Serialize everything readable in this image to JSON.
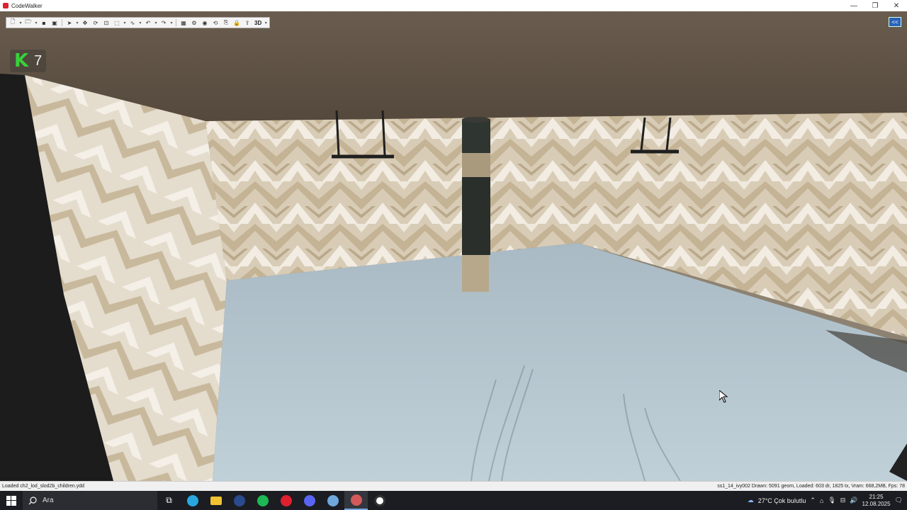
{
  "window": {
    "title": "CodeWalker",
    "controls": [
      "—",
      "❐",
      "✕"
    ]
  },
  "toolbar": {
    "view_mode": "3D",
    "collapse_label": "<<"
  },
  "overlay": {
    "counter_letter": "K",
    "counter_value": "7"
  },
  "status": {
    "left": "Loaded ch2_lod_slod2b_children.ydd",
    "right": "ss1_14_ivy002   Drawn: 5091 geom, Loaded: 603 dr, 1825 tx, Vram: 668,2MB, Fps: 78"
  },
  "taskbar": {
    "search_placeholder": "Ara",
    "weather": "27°C  Çok bulutlu",
    "time": "21:25",
    "date": "12.08.2025",
    "apps": [
      {
        "name": "task-view",
        "color": "#ffffff"
      },
      {
        "name": "edge",
        "color": "#2aa7e0"
      },
      {
        "name": "file-explorer",
        "color": "#f1c232"
      },
      {
        "name": "steam",
        "color": "#2a4b8d"
      },
      {
        "name": "spotify",
        "color": "#1db954"
      },
      {
        "name": "opera",
        "color": "#e0202f"
      },
      {
        "name": "discord",
        "color": "#5865f2"
      },
      {
        "name": "app-settings",
        "color": "#6fa8dc"
      },
      {
        "name": "codewalker",
        "color": "#d35a5a"
      },
      {
        "name": "chrome-like",
        "color": "#ffffff"
      }
    ]
  },
  "colors": {
    "ceiling": "#5b5044",
    "wall_light": "#ddd2c0",
    "wall_dark": "#c2b296",
    "floor": "#b6c6cf",
    "pillar_dark": "#2f3530",
    "pillar_light": "#a99a7e"
  }
}
